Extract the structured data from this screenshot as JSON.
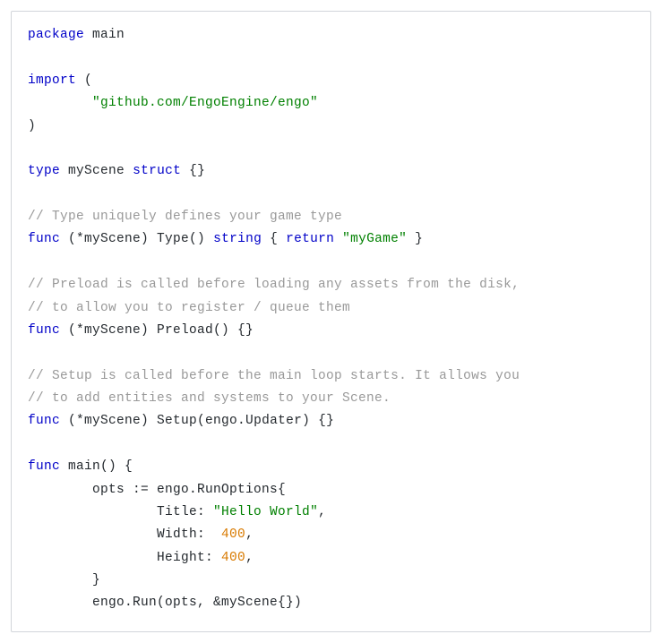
{
  "code": {
    "l1": {
      "kw1": "package",
      "sp1": " ",
      "id1": "main"
    },
    "l3": {
      "kw1": "import",
      "sp1": " ",
      "p1": "("
    },
    "l4": {
      "indent": "        ",
      "str1": "\"github.com/EngoEngine/engo\""
    },
    "l5": {
      "p1": ")"
    },
    "l7": {
      "kw1": "type",
      "sp1": " ",
      "id1": "myScene",
      "sp2": " ",
      "kw2": "struct",
      "sp3": " ",
      "p1": "{}"
    },
    "l9": {
      "com1": "// Type uniquely defines your game type"
    },
    "l10": {
      "kw1": "func",
      "sp1": " ",
      "p1": "(*myScene) Type() ",
      "kw2": "string",
      "sp2": " ",
      "p2": "{ ",
      "kw3": "return",
      "sp3": " ",
      "str1": "\"myGame\"",
      "p3": " }"
    },
    "l12": {
      "com1": "// Preload is called before loading any assets from the disk,"
    },
    "l13": {
      "com1": "// to allow you to register / queue them"
    },
    "l14": {
      "kw1": "func",
      "sp1": " ",
      "p1": "(*myScene) Preload() {}"
    },
    "l16": {
      "com1": "// Setup is called before the main loop starts. It allows you"
    },
    "l17": {
      "com1": "// to add entities and systems to your Scene."
    },
    "l18": {
      "kw1": "func",
      "sp1": " ",
      "p1": "(*myScene) Setup(engo.Updater) {}"
    },
    "l20": {
      "kw1": "func",
      "sp1": " ",
      "id1": "main() {",
      "p1": ""
    },
    "l21": {
      "indent": "        ",
      "id1": "opts := engo.RunOptions{"
    },
    "l22": {
      "indent": "                ",
      "id1": "Title: ",
      "str1": "\"Hello World\"",
      "p1": ","
    },
    "l23": {
      "indent": "                ",
      "id1": "Width:  ",
      "num1": "400",
      "p1": ","
    },
    "l24": {
      "indent": "                ",
      "id1": "Height: ",
      "num1": "400",
      "p1": ","
    },
    "l25": {
      "indent": "        ",
      "p1": "}"
    },
    "l26": {
      "indent": "        ",
      "id1": "engo.Run(opts, &myScene{})"
    }
  }
}
